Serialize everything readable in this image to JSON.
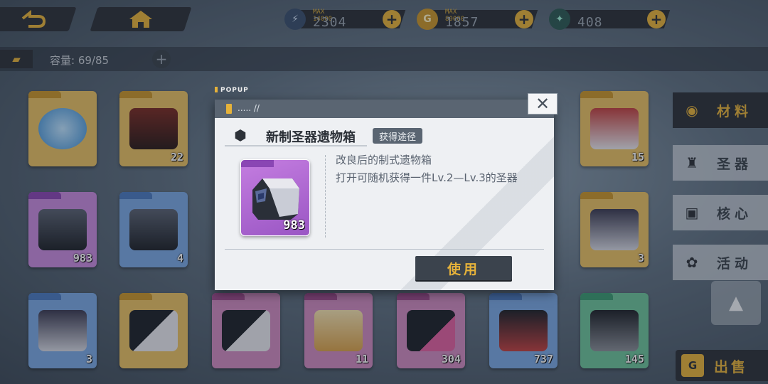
{
  "topbar": {
    "back_icon": "back-arrow-icon",
    "home_icon": "home-icon",
    "resources": [
      {
        "name": "stamina",
        "icon": "stamina-icon",
        "max_label": "MAX 14000",
        "value": "2304",
        "plus": "+"
      },
      {
        "name": "gold",
        "icon": "coin-icon",
        "glyph": "G",
        "max_label": "MAX 80000",
        "value": "1857",
        "plus": "+"
      },
      {
        "name": "crystal",
        "icon": "crystal-icon",
        "value": "408",
        "plus": "+"
      }
    ]
  },
  "capacity": {
    "label": "容量: 69/85",
    "plus": "+"
  },
  "grid": {
    "items": [
      {
        "name": "blue-orb",
        "count": "",
        "color": "#e6b23a"
      },
      {
        "name": "red-chest",
        "count": "22",
        "color": "#e6b23a"
      },
      {
        "name": "red-crest-box",
        "count": "15",
        "color": "#e6b23a"
      },
      {
        "name": "relic-box-purple",
        "count": "983",
        "color": "#b070d0"
      },
      {
        "name": "relic-box-blue",
        "count": "4",
        "color": "#5c8fd4"
      },
      {
        "name": "gold-ornate-box",
        "count": "3",
        "color": "#e6b23a"
      },
      {
        "name": "ornate-box-blue",
        "count": "3",
        "color": "#5c8fd4"
      },
      {
        "name": "gold-device",
        "count": "",
        "color": "#e6b23a"
      },
      {
        "name": "pink-device",
        "count": "",
        "color": "#d070b0"
      },
      {
        "name": "ticket",
        "count": "11",
        "color": "#d070b0"
      },
      {
        "name": "usb-drive",
        "count": "304",
        "color": "#d070b0"
      },
      {
        "name": "blue-cassette",
        "count": "737",
        "color": "#5c8fd4"
      },
      {
        "name": "green-cassette",
        "count": "145",
        "color": "#4cae84"
      }
    ]
  },
  "sidemenu": {
    "items": [
      {
        "label": "材料",
        "icon": "material-icon",
        "glyph": "◉",
        "active": true
      },
      {
        "label": "圣器",
        "icon": "artifact-icon",
        "glyph": "♜"
      },
      {
        "label": "核心",
        "icon": "core-icon",
        "glyph": "▣"
      },
      {
        "label": "活动",
        "icon": "event-icon",
        "glyph": "✿"
      }
    ],
    "scroll_up": "▲",
    "sell_label": "出售",
    "sell_icon_glyph": "G"
  },
  "popup": {
    "tag": "POPUP",
    "header_text": "..... //",
    "close": "✕",
    "title_icon_glyph": "⬢",
    "item_name": "新制圣器遗物箱",
    "obtain_label": "获得途径",
    "item_count": "983",
    "desc_line1": "改良后的制式遗物箱",
    "desc_line2": "打开可随机获得一件Lv.2—Lv.3的圣器",
    "use_label": "使用"
  }
}
